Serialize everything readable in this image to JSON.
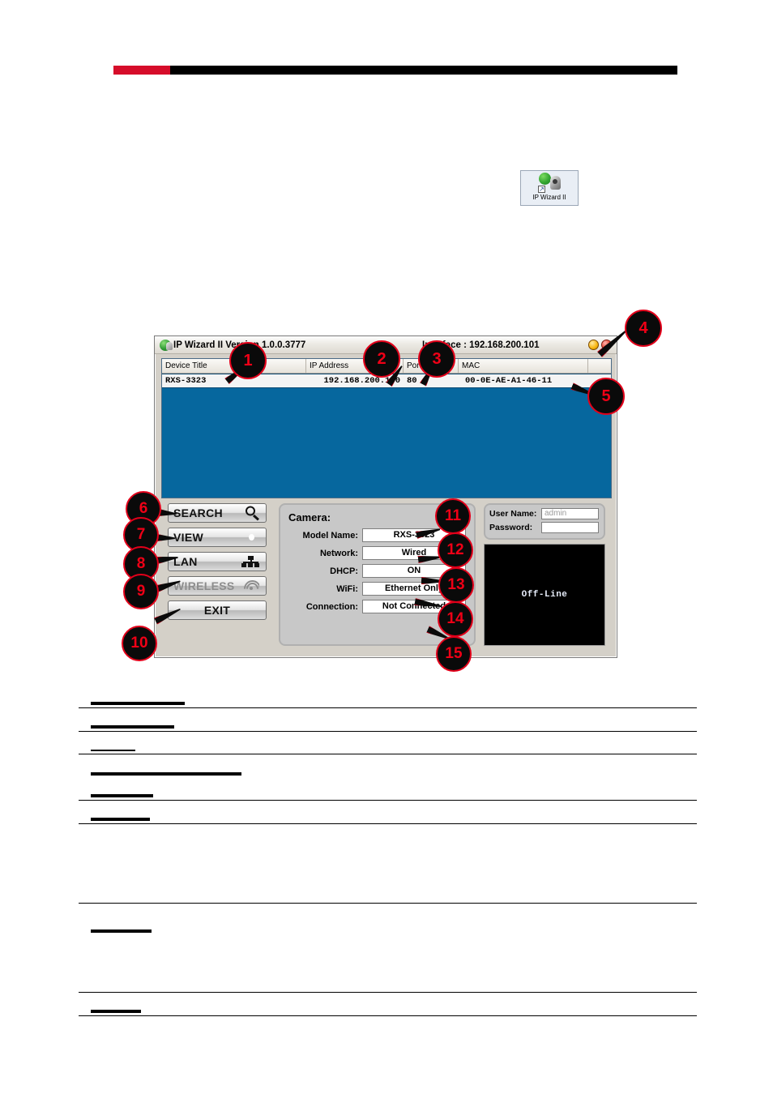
{
  "page": {
    "header_rule": {
      "red_color": "#d60d2a",
      "black_color": "#000000"
    }
  },
  "desktop_icon": {
    "label": "IP Wizard II",
    "icon": "ip-wizard-shortcut-icon",
    "shortcut_glyph": "↗"
  },
  "app_window": {
    "title": "IP Wizard II Version 1.0.0.3777",
    "interface_label": "Interface : 192.168.200.101",
    "window_buttons": [
      {
        "name": "minimize-button",
        "color": "#f7b50d"
      },
      {
        "name": "close-button",
        "color": "#e8442f"
      }
    ],
    "device_list": {
      "columns": [
        "Device Title",
        "IP Address",
        "Port",
        "MAC",
        ""
      ],
      "rows": [
        {
          "device_title": "RXS-3323",
          "ip_address": "192.168.200.100",
          "port": "80",
          "mac": "00-0E-AE-A1-46-11",
          "extra": ""
        }
      ],
      "background_color": "#06679e"
    },
    "buttons": [
      {
        "label": "SEARCH",
        "icon": "magnifier-icon",
        "enabled": true
      },
      {
        "label": "VIEW",
        "icon": "eye-icon",
        "enabled": true
      },
      {
        "label": "LAN",
        "icon": "network-icon",
        "enabled": true
      },
      {
        "label": "WIRELESS",
        "icon": "wifi-icon",
        "enabled": false
      },
      {
        "label": "EXIT",
        "icon": "",
        "enabled": true
      }
    ],
    "camera_panel": {
      "title": "Camera:",
      "fields": [
        {
          "label": "Model Name:",
          "value": "RXS-3323"
        },
        {
          "label": "Network:",
          "value": "Wired"
        },
        {
          "label": "DHCP:",
          "value": "ON"
        },
        {
          "label": "WiFi:",
          "value": "Ethernet Only"
        },
        {
          "label": "Connection:",
          "value": "Not Connected"
        }
      ]
    },
    "credentials": {
      "username_label": "User Name:",
      "username_value": "admin",
      "password_label": "Password:",
      "password_value": ""
    },
    "video_preview": {
      "status": "Off-Line"
    }
  },
  "callouts": [
    {
      "n": "1"
    },
    {
      "n": "2"
    },
    {
      "n": "3"
    },
    {
      "n": "4"
    },
    {
      "n": "5"
    },
    {
      "n": "6"
    },
    {
      "n": "7"
    },
    {
      "n": "8"
    },
    {
      "n": "9"
    },
    {
      "n": "10"
    },
    {
      "n": "11"
    },
    {
      "n": "12"
    },
    {
      "n": "13"
    },
    {
      "n": "14"
    },
    {
      "n": "15"
    }
  ]
}
